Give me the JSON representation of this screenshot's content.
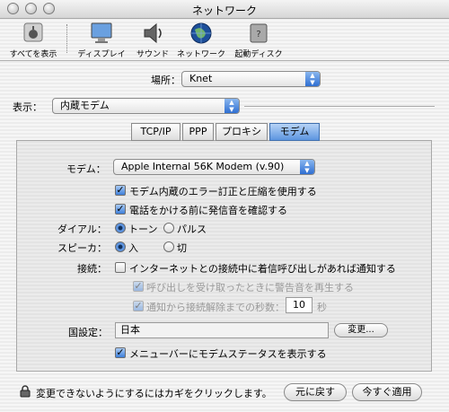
{
  "window": {
    "title": "ネットワーク"
  },
  "toolbar": {
    "items": [
      {
        "label": "すべてを表示",
        "icon": "apple-icon"
      },
      {
        "label": "ディスプレイ",
        "icon": "display-icon"
      },
      {
        "label": "サウンド",
        "icon": "speaker-icon"
      },
      {
        "label": "ネットワーク",
        "icon": "globe-icon"
      },
      {
        "label": "起動ディスク",
        "icon": "disk-icon"
      }
    ]
  },
  "location": {
    "label": "場所：",
    "value": "Knet"
  },
  "show": {
    "label": "表示：",
    "value": "内蔵モデム"
  },
  "tabs": [
    {
      "label": "TCP/IP",
      "selected": false
    },
    {
      "label": "PPP",
      "selected": false
    },
    {
      "label": "プロキシ",
      "selected": false
    },
    {
      "label": "モデム",
      "selected": true
    }
  ],
  "modem": {
    "modem_label": "モデム：",
    "modem_value": "Apple Internal 56K Modem (v.90)",
    "error_correction": {
      "label": "モデム内蔵のエラー訂正と圧縮を使用する",
      "checked": true
    },
    "dial_tone": {
      "label": "電話をかける前に発信音を確認する",
      "checked": true
    },
    "dialing": {
      "label": "ダイアル：",
      "options": [
        "トーン",
        "パルス"
      ],
      "selected": "トーン"
    },
    "speaker": {
      "label": "スピーカ：",
      "options": [
        "入",
        "切"
      ],
      "selected": "入"
    },
    "connection": {
      "label": "接続：",
      "notify": {
        "label": "インターネットとの接続中に着信呼び出しがあれば通知する",
        "checked": false
      },
      "alert_sound": {
        "label": "呼び出しを受け取ったときに警告音を再生する",
        "checked": true,
        "enabled": false
      },
      "disconnect": {
        "label": "通知から接続解除までの秒数：",
        "value": "10",
        "unit": "秒",
        "checked": true,
        "enabled": false
      }
    },
    "country": {
      "label": "国設定：",
      "value": "日本",
      "change_button": "変更..."
    },
    "menubar": {
      "label": "メニューバーにモデムステータスを表示する",
      "checked": true
    }
  },
  "footer": {
    "lock_text": "変更できないようにするにはカギをクリックします。",
    "revert_button": "元に戻す",
    "apply_button": "今すぐ適用"
  },
  "colors": {
    "accent": "#3e7fd9",
    "tab_selected": "#5d95e0"
  }
}
